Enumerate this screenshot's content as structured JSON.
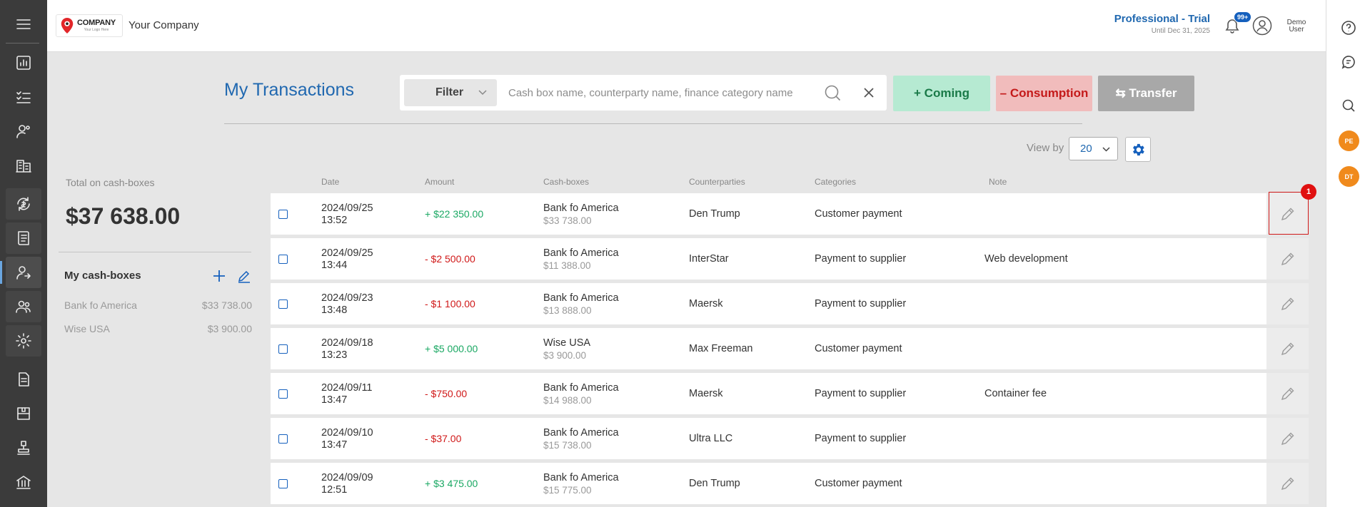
{
  "app": {
    "company_name": "Your Company",
    "logo_main": "COMPANY",
    "logo_sub": "Your Logo Here"
  },
  "header": {
    "plan_title": "Professional - Trial",
    "plan_until": "Until Dec 31, 2025",
    "notif_count": "99+",
    "user_line1": "Demo",
    "user_line2": "User"
  },
  "rightbar": {
    "avatars": [
      "PE",
      "DT"
    ]
  },
  "toolbar": {
    "page_title": "My Transactions",
    "filter_label": "Filter",
    "search_placeholder": "Cash box name, counterparty name, finance category name",
    "coming_label": "+ Coming",
    "consumption_label": "– Consumption",
    "transfer_label": "⇆ Transfer",
    "viewby_label": "View by",
    "viewby_value": "20"
  },
  "summary": {
    "total_label": "Total on cash-boxes",
    "total_value": "$37 638.00",
    "mycb_title": "My cash-boxes",
    "cash_boxes": [
      {
        "name": "Bank fo America",
        "amount": "$33 738.00"
      },
      {
        "name": "Wise USA",
        "amount": "$3 900.00"
      }
    ]
  },
  "table": {
    "headers": {
      "date": "Date",
      "amount": "Amount",
      "cashbox": "Cash-boxes",
      "counterparty": "Counterparties",
      "category": "Categories",
      "note": "Note"
    },
    "rows": [
      {
        "date": "2024/09/25",
        "time": "13:52",
        "amount": "+ $22 350.00",
        "sign": "pos",
        "box": "Bank fo America",
        "balance": "$33 738.00",
        "counterparty": "Den Trump",
        "category": "Customer payment",
        "note": ""
      },
      {
        "date": "2024/09/25",
        "time": "13:44",
        "amount": "- $2 500.00",
        "sign": "neg",
        "box": "Bank fo America",
        "balance": "$11 388.00",
        "counterparty": "InterStar",
        "category": "Payment to supplier",
        "note": "Web development"
      },
      {
        "date": "2024/09/23",
        "time": "13:48",
        "amount": "- $1 100.00",
        "sign": "neg",
        "box": "Bank fo America",
        "balance": "$13 888.00",
        "counterparty": "Maersk",
        "category": "Payment to supplier",
        "note": ""
      },
      {
        "date": "2024/09/18",
        "time": "13:23",
        "amount": "+ $5 000.00",
        "sign": "pos",
        "box": "Wise USA",
        "balance": "$3 900.00",
        "counterparty": "Max Freeman",
        "category": "Customer payment",
        "note": ""
      },
      {
        "date": "2024/09/11",
        "time": "13:47",
        "amount": "- $750.00",
        "sign": "neg",
        "box": "Bank fo America",
        "balance": "$14 988.00",
        "counterparty": "Maersk",
        "category": "Payment to supplier",
        "note": "Container fee"
      },
      {
        "date": "2024/09/10",
        "time": "13:47",
        "amount": "- $37.00",
        "sign": "neg",
        "box": "Bank fo America",
        "balance": "$15 738.00",
        "counterparty": "Ultra LLC",
        "category": "Payment to supplier",
        "note": ""
      },
      {
        "date": "2024/09/09",
        "time": "12:51",
        "amount": "+ $3 475.00",
        "sign": "pos",
        "box": "Bank fo America",
        "balance": "$15 775.00",
        "counterparty": "Den Trump",
        "category": "Customer payment",
        "note": ""
      }
    ]
  },
  "annotation": {
    "marker": "1"
  },
  "colors": {
    "accent": "#2068b0",
    "positive": "#1aa863",
    "negative": "#d01818",
    "sidebar": "#3b3b3b"
  }
}
